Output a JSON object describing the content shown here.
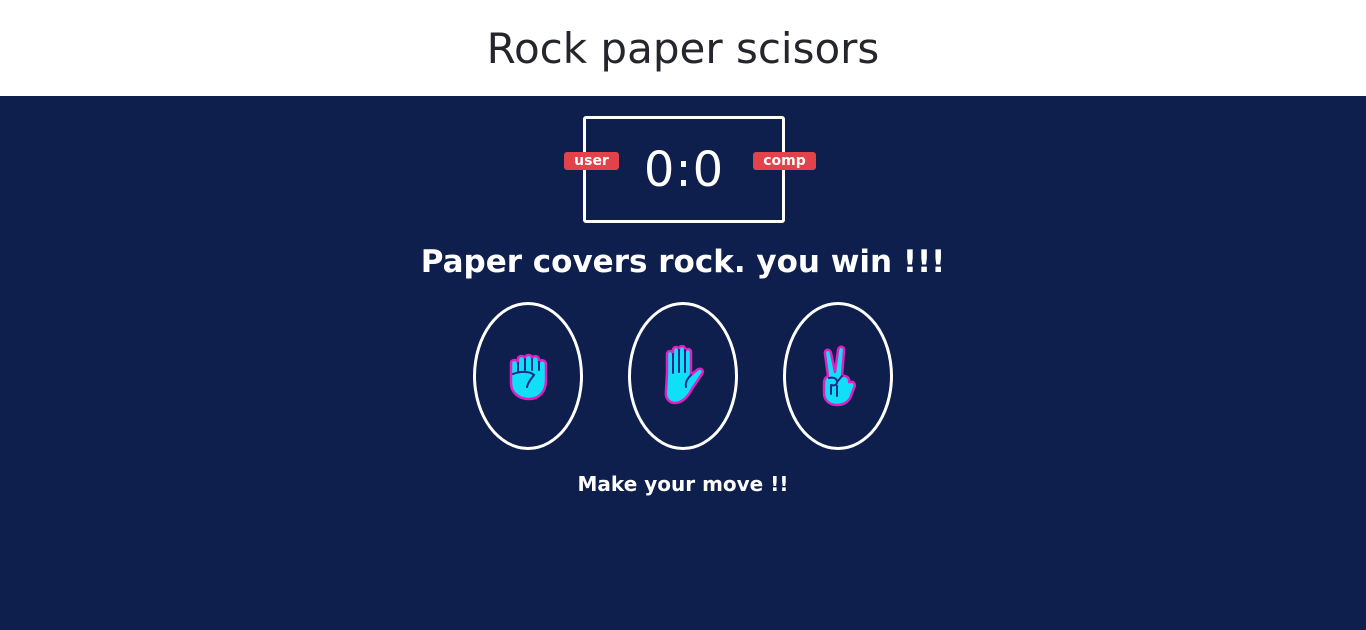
{
  "header": {
    "title": "Rock paper scisors"
  },
  "scoreboard": {
    "user_label": "user",
    "comp_label": "comp",
    "score": "0:0"
  },
  "result_message": "Paper covers rock. you win !!!",
  "choices": [
    {
      "id": "rock",
      "icon": "fist-icon"
    },
    {
      "id": "paper",
      "icon": "raised-hand-icon"
    },
    {
      "id": "scissors",
      "icon": "victory-hand-icon"
    }
  ],
  "prompt": "Make your move !!",
  "colors": {
    "background": "#0e1f4d",
    "header_bg": "#ffffff",
    "badge": "#e2424a",
    "icon_fill": "#10e0f7",
    "icon_outline": "#e020c0"
  }
}
